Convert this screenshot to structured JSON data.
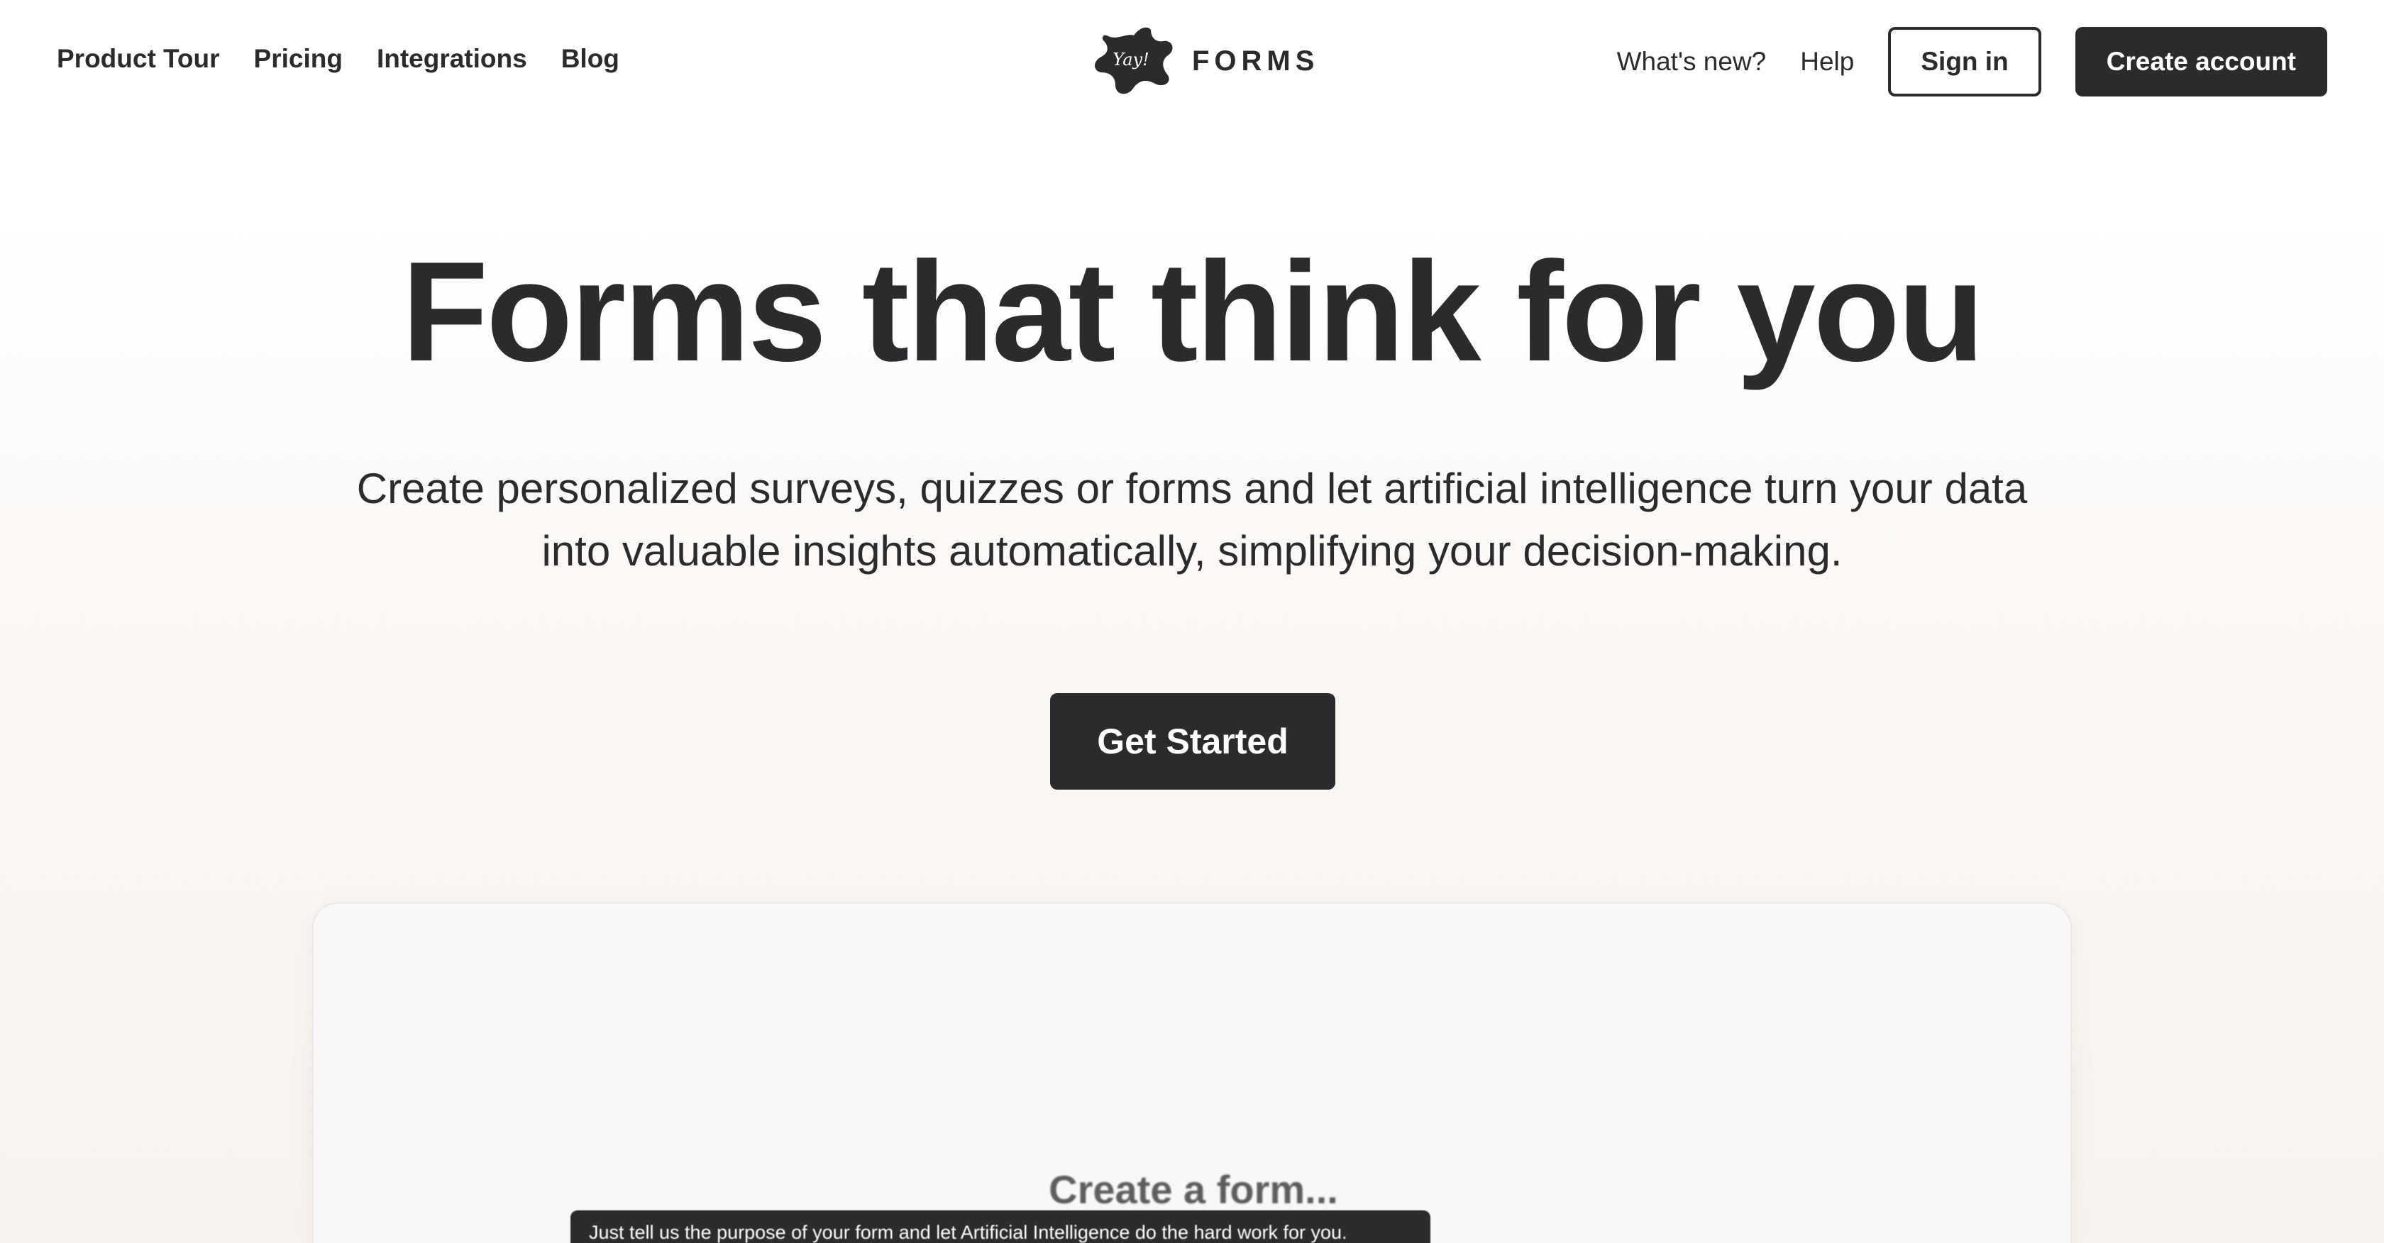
{
  "nav": {
    "left_links": [
      "Product Tour",
      "Pricing",
      "Integrations",
      "Blog"
    ],
    "logo_mark_text": "Yay!",
    "logo_text": "FORMS",
    "whats_new": "What's new?",
    "help": "Help",
    "sign_in": "Sign in",
    "create_account": "Create account"
  },
  "hero": {
    "title": "Forms that think for you",
    "subtitle_line1": "Create personalized surveys, quizzes or forms and let artificial intelligence turn your data",
    "subtitle_line2": "into valuable insights automatically, simplifying your decision-making.",
    "cta": "Get Started"
  },
  "preview": {
    "title": "Create a form...",
    "tooltip": "Just tell us the purpose of your form and let Artificial Intelligence do the hard work for you."
  },
  "colors": {
    "text": "#2b2a2d",
    "button_bg": "#2b2a2d",
    "button_text": "#ffffff",
    "background_top": "#ffffff",
    "background_bottom": "#f7f2ee"
  }
}
